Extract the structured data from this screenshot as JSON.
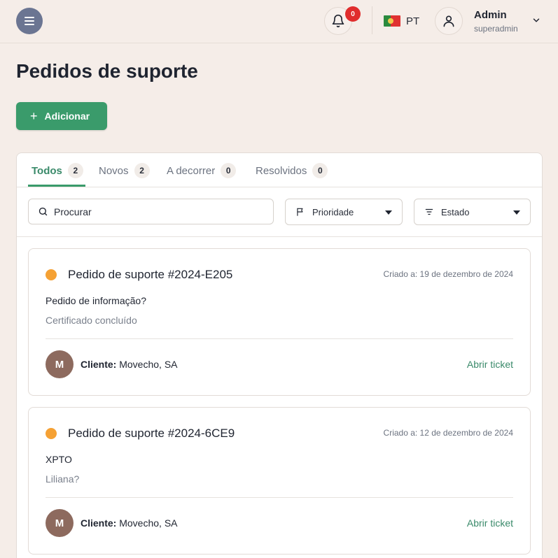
{
  "header": {
    "notification_count": "0",
    "language": "PT",
    "user": {
      "name": "Admin",
      "role": "superadmin"
    }
  },
  "page": {
    "title": "Pedidos de suporte",
    "add_label": "Adicionar"
  },
  "tabs": [
    {
      "label": "Todos",
      "count": "2",
      "active": true
    },
    {
      "label": "Novos",
      "count": "2",
      "active": false
    },
    {
      "label": "A decorrer",
      "count": "0",
      "active": false
    },
    {
      "label": "Resolvidos",
      "count": "0",
      "active": false
    }
  ],
  "filters": {
    "search_placeholder": "Procurar",
    "priority_label": "Prioridade",
    "status_label": "Estado"
  },
  "tickets": [
    {
      "title": "Pedido de suporte #2024-E205",
      "created": "Criado a: 19 de dezembro de 2024",
      "subject": "Pedido de informação?",
      "description": "Certificado concluído",
      "client_initial": "M",
      "client_label": "Cliente:",
      "client_name": "Movecho, SA",
      "open_label": "Abrir ticket",
      "status_color": "#f5a134"
    },
    {
      "title": "Pedido de suporte #2024-6CE9",
      "created": "Criado a: 12 de dezembro de 2024",
      "subject": "XPTO",
      "description": "Liliana?",
      "client_initial": "M",
      "client_label": "Cliente:",
      "client_name": "Movecho, SA",
      "open_label": "Abrir ticket",
      "status_color": "#f5a134"
    }
  ],
  "colors": {
    "background": "#f5ede8",
    "accent": "#3a9b6b",
    "menu_button": "#6b7592",
    "badge": "#e02d2d",
    "avatar": "#8d6a5e"
  }
}
